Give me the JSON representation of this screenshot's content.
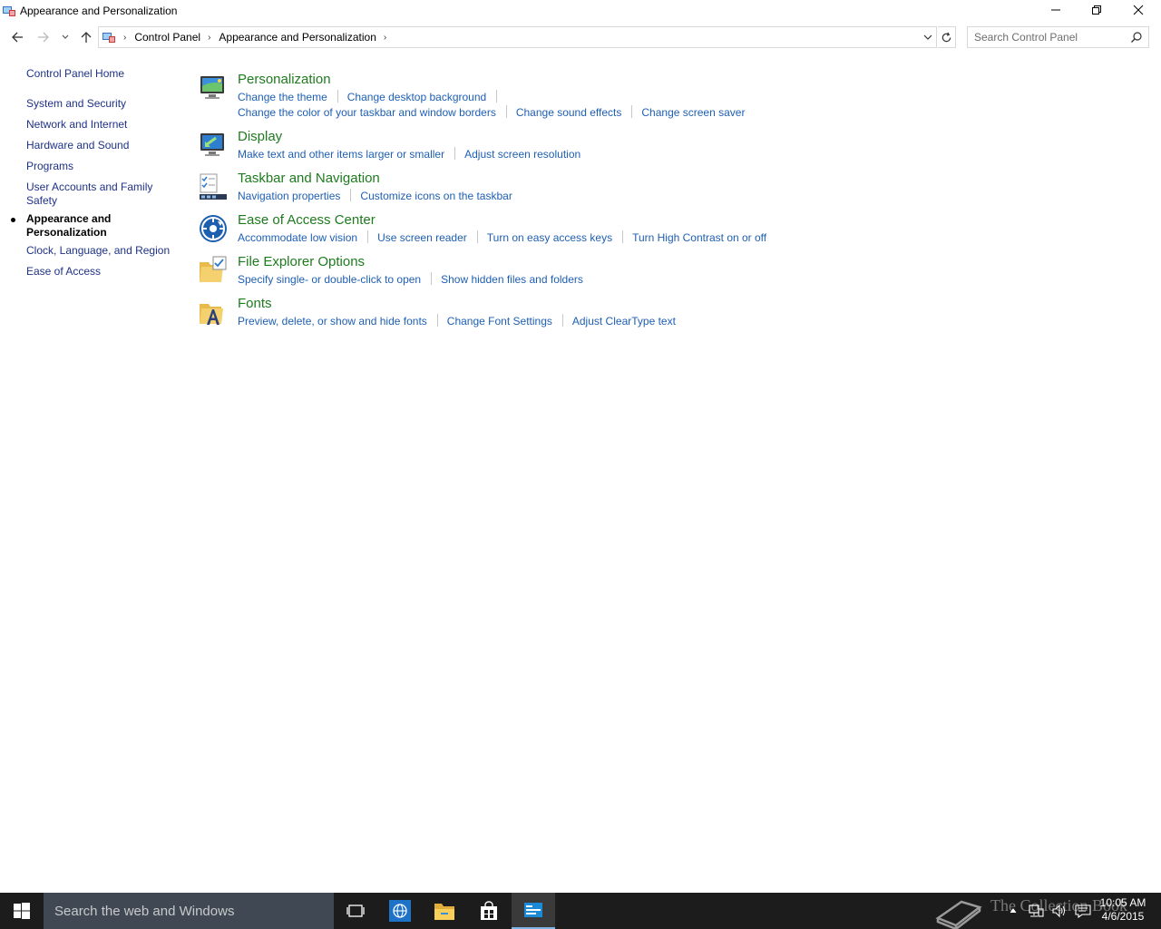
{
  "window": {
    "title": "Appearance and Personalization"
  },
  "address": {
    "breadcrumbs": [
      "Control Panel",
      "Appearance and Personalization"
    ],
    "search_placeholder": "Search Control Panel"
  },
  "leftnav": {
    "home": "Control Panel Home",
    "items": [
      "System and Security",
      "Network and Internet",
      "Hardware and Sound",
      "Programs",
      "User Accounts and Family Safety",
      "Appearance and Personalization",
      "Clock, Language, and Region",
      "Ease of Access"
    ],
    "current": "Appearance and Personalization"
  },
  "categories": [
    {
      "title": "Personalization",
      "icon": "personalization-icon",
      "rows": [
        [
          "Change the theme",
          "Change desktop background"
        ],
        [
          "Change the color of your taskbar and window borders",
          "Change sound effects",
          "Change screen saver"
        ]
      ]
    },
    {
      "title": "Display",
      "icon": "display-icon",
      "rows": [
        [
          "Make text and other items larger or smaller",
          "Adjust screen resolution"
        ]
      ]
    },
    {
      "title": "Taskbar and Navigation",
      "icon": "taskbar-icon",
      "rows": [
        [
          "Navigation properties",
          "Customize icons on the taskbar"
        ]
      ]
    },
    {
      "title": "Ease of Access Center",
      "icon": "ease-of-access-icon",
      "rows": [
        [
          "Accommodate low vision",
          "Use screen reader",
          "Turn on easy access keys",
          "Turn High Contrast on or off"
        ]
      ]
    },
    {
      "title": "File Explorer Options",
      "icon": "folder-options-icon",
      "rows": [
        [
          "Specify single- or double-click to open",
          "Show hidden files and folders"
        ]
      ]
    },
    {
      "title": "Fonts",
      "icon": "fonts-icon",
      "rows": [
        [
          "Preview, delete, or show and hide fonts",
          "Change Font Settings",
          "Adjust ClearType text"
        ]
      ]
    }
  ],
  "taskbar": {
    "search_placeholder": "Search the web and Windows",
    "time": "10:05 AM",
    "date": "4/6/2015",
    "watermark": "The Collection Book"
  },
  "colors": {
    "heading": "#1e7b1e",
    "task_link": "#1e5fb4",
    "nav_link": "#1e3287",
    "taskbar": "#1c1c1c",
    "taskbar_search": "#3f4853"
  }
}
